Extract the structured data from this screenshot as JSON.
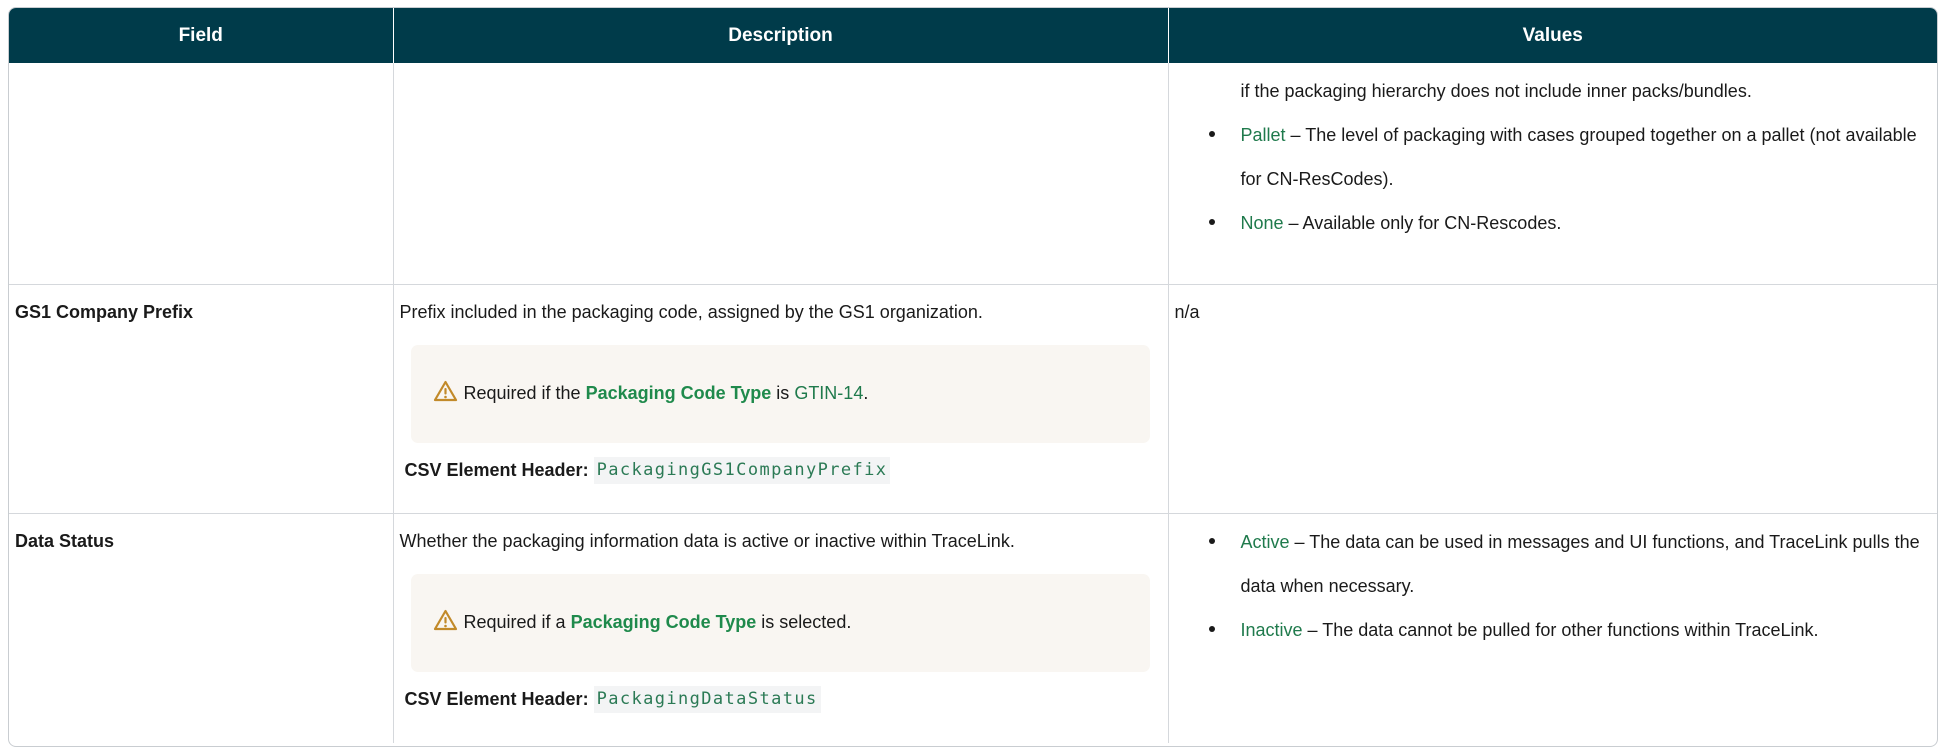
{
  "table": {
    "headers": [
      "Field",
      "Description",
      "Values"
    ],
    "rows": [
      {
        "values_continued": "if the packaging hierarchy does not include inner packs/bundles.",
        "values_items": [
          {
            "term": "Pallet",
            "text": " – The level of packaging with cases grouped together on a pallet (not available for CN-ResCodes)."
          },
          {
            "term": "None",
            "text": " – Available only for CN-Rescodes."
          }
        ]
      },
      {
        "field": "GS1 Company Prefix",
        "description": "Prefix included in the packaging code, assigned by the GS1 organization.",
        "note": {
          "prefix": "Required if the ",
          "link": "Packaging Code Type",
          "middle": " is ",
          "value": "GTIN-14",
          "suffix": "."
        },
        "csv_label": "CSV Element Header:",
        "csv_value": "PackagingGS1CompanyPrefix",
        "values_text": "n/a"
      },
      {
        "field": "Data Status",
        "description": "Whether the packaging information data is active or inactive within TraceLink.",
        "note": {
          "prefix": "Required if a ",
          "link": "Packaging Code Type",
          "suffix": " is selected."
        },
        "csv_label": "CSV Element Header:",
        "csv_value": "PackagingDataStatus",
        "values_items": [
          {
            "term": "Active",
            "text": " – The data can be used in messages and UI functions, and TraceLink pulls the data when necessary."
          },
          {
            "term": "Inactive",
            "text": " – The data cannot be pulled for other functions within TraceLink."
          }
        ]
      }
    ]
  },
  "colors": {
    "header_bg": "#003b4a",
    "link_green": "#1f8a4c",
    "note_bg": "#f9f6f2",
    "warning_icon": "#c28a2a"
  }
}
